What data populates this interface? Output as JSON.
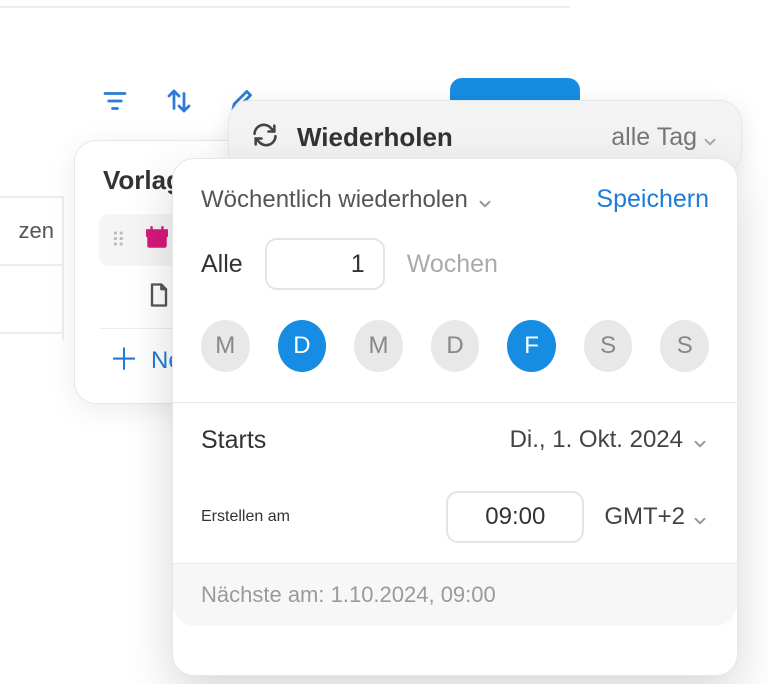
{
  "toolbar": {
    "filter_icon": "filter-icon",
    "sort_icon": "sort-icon"
  },
  "sidebar": {
    "item_label": "zen"
  },
  "templates": {
    "heading": "Vorlagen",
    "new_label": "Neu"
  },
  "repeat_header": {
    "title": "Wiederholen",
    "frequency_label": "alle Tag"
  },
  "repeat_panel": {
    "mode_label": "Wöchentlich wiederholen",
    "save_label": "Speichern",
    "every_label": "Alle",
    "interval_value": "1",
    "unit_label": "Wochen",
    "days": [
      {
        "abbr": "M",
        "active": false
      },
      {
        "abbr": "D",
        "active": true
      },
      {
        "abbr": "M",
        "active": false
      },
      {
        "abbr": "D",
        "active": false
      },
      {
        "abbr": "F",
        "active": true
      },
      {
        "abbr": "S",
        "active": false
      },
      {
        "abbr": "S",
        "active": false
      }
    ],
    "starts_label": "Starts",
    "starts_value": "Di., 1. Okt. 2024",
    "create_at_label": "Erstellen am",
    "create_at_time": "09:00",
    "timezone_label": "GMT+2",
    "next_label": "Nächste am: 1.10.2024, 09:00"
  }
}
